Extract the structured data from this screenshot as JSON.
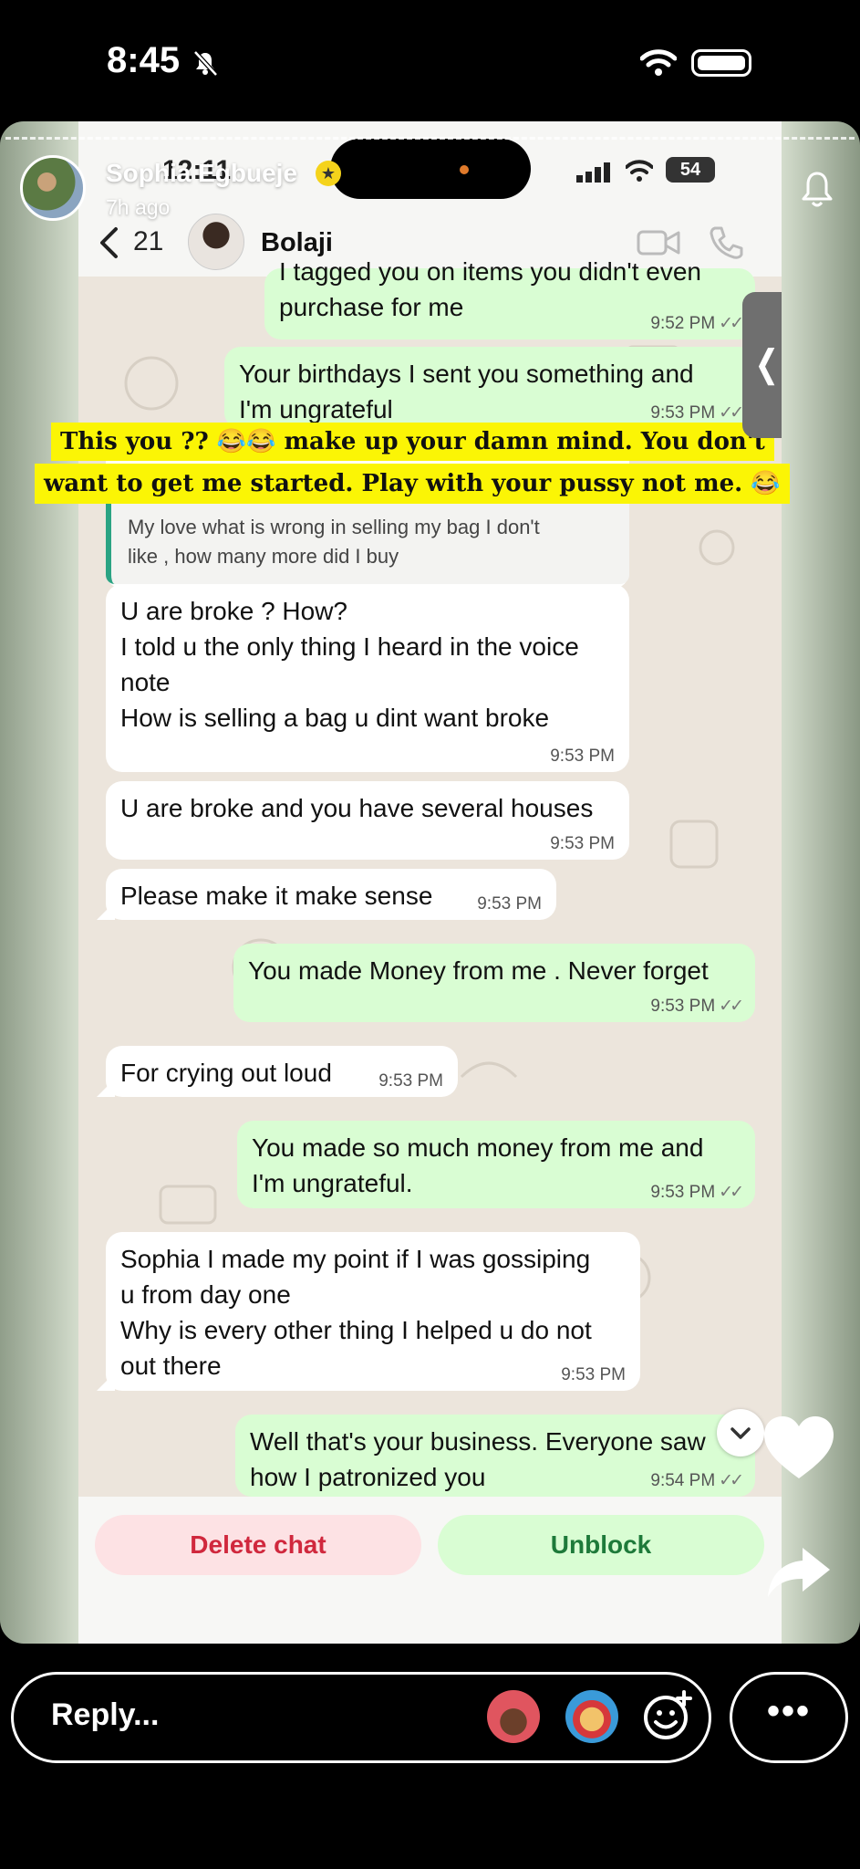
{
  "status_bar": {
    "time": "8:45"
  },
  "inner_status": {
    "time": "12:11",
    "battery": "54"
  },
  "story": {
    "user_name": "Sophia Egbueje",
    "posted_ago": "7h ago"
  },
  "whatsapp_header": {
    "back_count": "21",
    "contact_name": "Bolaji"
  },
  "messages": [
    {
      "side": "out",
      "text": "I tagged you on items you didn't even\npurchase for me",
      "time": "9:52 PM"
    },
    {
      "side": "out",
      "text": "Your birthdays I sent  you something and\nI'm ungrateful",
      "time": "9:53 PM"
    },
    {
      "side": "in",
      "text": "U are broke ? How?\nI told u the only thing I heard in the voice\nnote\nHow is selling a bag u dint want broke",
      "time": "9:53 PM"
    },
    {
      "side": "in",
      "text": "U are broke and you have several houses",
      "time": "9:53 PM"
    },
    {
      "side": "in",
      "text": "Please make it make sense",
      "time": "9:53 PM"
    },
    {
      "side": "out",
      "text": "You made Money from me . Never forget",
      "time": "9:53 PM"
    },
    {
      "side": "in",
      "text": "For crying out loud",
      "time": "9:53 PM"
    },
    {
      "side": "out",
      "text": "You made so much money from me and\nI'm ungrateful.",
      "time": "9:53 PM"
    },
    {
      "side": "in",
      "text": "Sophia I made my point if I was gossiping\nu from day one\nWhy is every other thing I helped u do not\nout there",
      "time": "9:53 PM"
    },
    {
      "side": "out",
      "text": "Well that's your business. Everyone saw\nhow I patronized you",
      "time": "9:54 PM"
    }
  ],
  "quoted_reply": {
    "text": "My love what is wrong in selling my bag I don't\nlike , how many more did I buy"
  },
  "caption": {
    "line1": "This you ?? 😂😂 make up your damn mind. You don't",
    "line2": "want to get me started. Play with your pussy not me.  😂"
  },
  "actions": {
    "delete": "Delete chat",
    "unblock": "Unblock"
  },
  "reply_bar": {
    "placeholder": "Reply..."
  },
  "icons": [
    "bell-mute-icon",
    "wifi-icon",
    "battery-icon",
    "back-chevron-icon",
    "video-call-icon",
    "phone-icon",
    "notification-bell-icon",
    "heart-icon",
    "share-arrow-icon",
    "add-reaction-icon",
    "more-icon"
  ]
}
